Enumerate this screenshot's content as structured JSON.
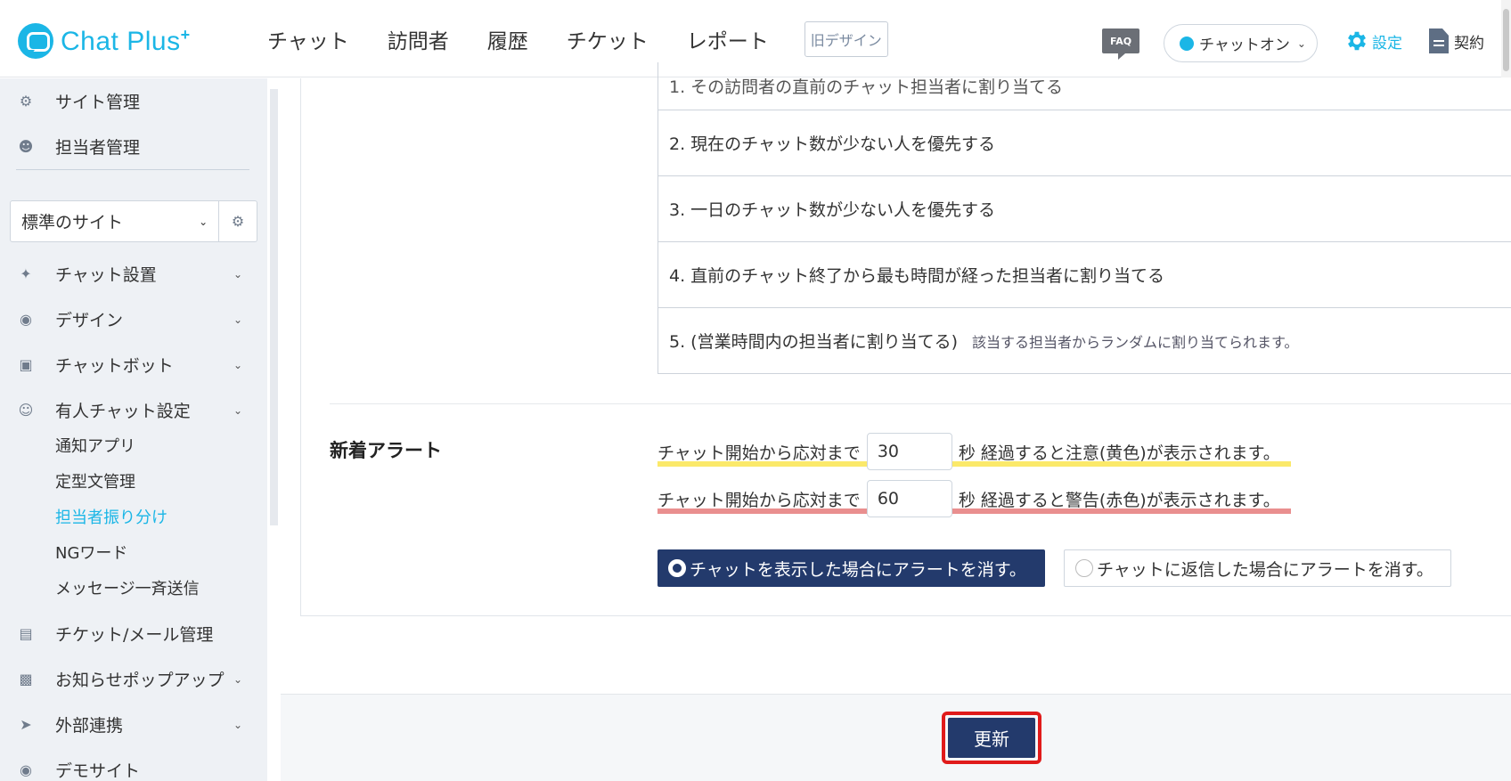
{
  "header": {
    "logo_text": "Chat Plus",
    "logo_sup": "+",
    "nav": [
      "チャット",
      "訪問者",
      "履歴",
      "チケット",
      "レポート"
    ],
    "old_design": "旧デザイン",
    "faq": "FAQ",
    "status": "チャットオン",
    "settings": "設定",
    "contract": "契約",
    "accent_color": "#1bb6e6"
  },
  "sidebar": {
    "top_items": [
      "サイト管理",
      "担当者管理"
    ],
    "site_select": "標準のサイト",
    "menu": [
      "チャット設置",
      "デザイン",
      "チャットボット",
      "有人チャット設定"
    ],
    "sub_items": [
      "通知アプリ",
      "定型文管理",
      "担当者振り分け",
      "NGワード",
      "メッセージ一斉送信"
    ],
    "menu_after": [
      "チケット/メール管理",
      "お知らせポップアップ",
      "外部連携",
      "デモサイト"
    ]
  },
  "options": [
    "1. その訪問者の直前のチャット担当者に割り当てる",
    "2. 現在のチャット数が少ない人を優先する",
    "3. 一日のチャット数が少ない人を優先する",
    "4. 直前のチャット終了から最も時間が経った担当者に割り当てる",
    "5. (営業時間内の担当者に割り当てる)"
  ],
  "option5_note": "該当する担当者からランダムに割り当てられます。",
  "alert": {
    "title": "新着アラート",
    "prefix": "チャット開始から応対まで",
    "warn_value": "30",
    "warn_suffix": "秒 経過すると注意(黄色)が表示されます。",
    "danger_value": "60",
    "danger_suffix": "秒 経過すると警告(赤色)が表示されます。",
    "radio_selected": "チャットを表示した場合にアラートを消す。",
    "radio_unselected": "チャットに返信した場合にアラートを消す。"
  },
  "update_button": "更新"
}
